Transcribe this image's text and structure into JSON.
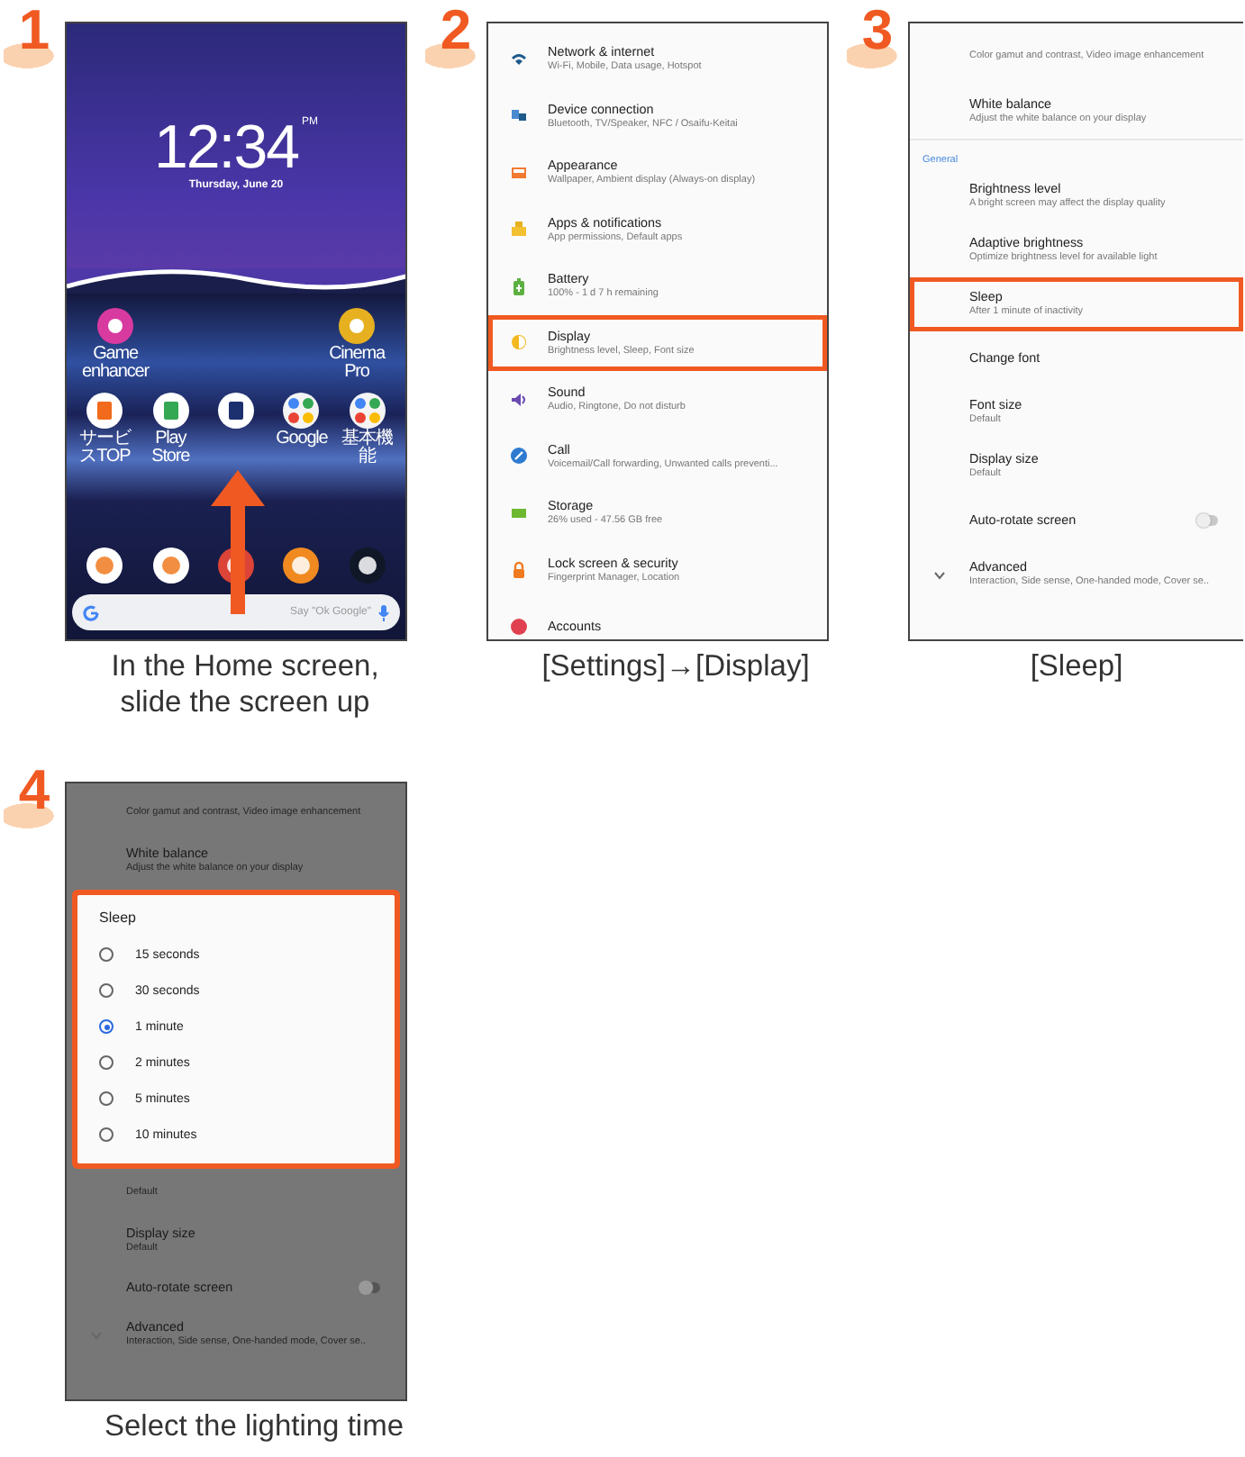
{
  "steps": [
    {
      "number": "1",
      "caption": "In the Home screen, slide the screen up",
      "screen": {
        "kind": "home",
        "clock": "12:34",
        "ampm": "PM",
        "date": "Thursday, June 20",
        "top_apps": [
          {
            "label": "Game enhancer"
          },
          {
            "label": "Cinema Pro"
          }
        ],
        "apps": [
          {
            "kind": "app",
            "label": "サービスTOP"
          },
          {
            "kind": "app",
            "label": "Play Store"
          },
          {
            "kind": "app"
          },
          {
            "kind": "folder",
            "label": "Google"
          },
          {
            "kind": "folder",
            "label": "基本機能"
          }
        ],
        "search": {
          "placeholder": "Say \"Ok Google\""
        },
        "swipe_arrow": true
      }
    },
    {
      "number": "2",
      "caption": "[Settings]→[Display]",
      "screen": {
        "kind": "settings",
        "items": [
          {
            "kind": "icon_item",
            "title": "Network & internet",
            "subtitle": "Wi-Fi, Mobile, Data usage, Hotspot",
            "highlighted": false
          },
          {
            "kind": "icon_item",
            "title": "Device connection",
            "subtitle": "Bluetooth, TV/Speaker, NFC / Osaifu-Keitai",
            "highlighted": false
          },
          {
            "kind": "icon_item",
            "title": "Appearance",
            "subtitle": "Wallpaper, Ambient display (Always-on display)",
            "highlighted": false
          },
          {
            "kind": "icon_item",
            "title": "Apps & notifications",
            "subtitle": "App permissions, Default apps",
            "highlighted": false
          },
          {
            "kind": "icon_item",
            "title": "Battery",
            "subtitle": "100% - 1 d 7 h remaining",
            "highlighted": false
          },
          {
            "kind": "icon_item",
            "title": "Display",
            "subtitle": "Brightness level, Sleep, Font size",
            "highlighted": true
          },
          {
            "kind": "icon_item",
            "title": "Sound",
            "subtitle": "Audio, Ringtone, Do not disturb",
            "highlighted": false
          },
          {
            "kind": "icon_item",
            "title": "Call",
            "subtitle": "Voicemail/Call forwarding, Unwanted calls preventi...",
            "highlighted": false
          },
          {
            "kind": "icon_item",
            "title": "Storage",
            "subtitle": "26% used - 47.56 GB free",
            "highlighted": false
          },
          {
            "kind": "icon_item",
            "title": "Lock screen & security",
            "subtitle": "Fingerprint Manager, Location",
            "highlighted": false
          },
          {
            "kind": "icon_item",
            "title": "Accounts",
            "highlighted": false
          }
        ]
      }
    },
    {
      "number": "3",
      "caption": "[Sleep]",
      "screen": {
        "kind": "settings",
        "items": [
          {
            "kind": "item",
            "subtitle": "Color gamut and contrast, Video image enhancement",
            "highlighted": false
          },
          {
            "kind": "item",
            "title": "White balance",
            "subtitle": "Adjust the white balance on your display",
            "highlighted": false
          },
          {
            "kind": "header",
            "title": "General"
          },
          {
            "kind": "item",
            "title": "Brightness level",
            "subtitle": "A bright screen may affect the display quality",
            "highlighted": false
          },
          {
            "kind": "item",
            "title": "Adaptive brightness",
            "subtitle": "Optimize brightness level for available light",
            "highlighted": false
          },
          {
            "kind": "item",
            "title": "Sleep",
            "subtitle": "After 1 minute of inactivity",
            "highlighted": true
          },
          {
            "kind": "item",
            "title": "Change font",
            "highlighted": false
          },
          {
            "kind": "item",
            "title": "Font size",
            "subtitle": "Default",
            "highlighted": false
          },
          {
            "kind": "item",
            "title": "Display size",
            "subtitle": "Default",
            "highlighted": false
          },
          {
            "kind": "toggle",
            "title": "Auto-rotate screen",
            "on": false
          },
          {
            "kind": "expand",
            "title": "Advanced",
            "subtitle": "Interaction, Side sense, One-handed mode, Cover se..",
            "expanded": false
          }
        ]
      }
    },
    {
      "number": "4",
      "caption": "Select the lighting time",
      "screen": {
        "kind": "dialog",
        "items_before": [
          {
            "kind": "item",
            "subtitle": "Color gamut and contrast, Video image enhancement",
            "highlighted": false
          },
          {
            "kind": "item",
            "title": "White balance",
            "subtitle": "Adjust the white balance on your display",
            "highlighted": false
          }
        ],
        "dialog": {
          "title": "Sleep",
          "highlighted": true,
          "options": [
            {
              "label": "15 seconds",
              "selected": false
            },
            {
              "label": "30 seconds",
              "selected": false
            },
            {
              "label": "1 minute",
              "selected": true
            },
            {
              "label": "2 minutes",
              "selected": false
            },
            {
              "label": "5 minutes",
              "selected": false
            },
            {
              "label": "10 minutes",
              "selected": false
            }
          ]
        },
        "items_after": [
          {
            "kind": "item",
            "subtitle": "Default",
            "highlighted": false
          },
          {
            "kind": "item",
            "title": "Display size",
            "subtitle": "Default",
            "highlighted": false
          },
          {
            "kind": "toggle",
            "title": "Auto-rotate screen",
            "on": false
          },
          {
            "kind": "expand",
            "title": "Advanced",
            "subtitle": "Interaction, Side sense, One-handed mode, Cover se..",
            "expanded": false
          }
        ]
      }
    }
  ]
}
